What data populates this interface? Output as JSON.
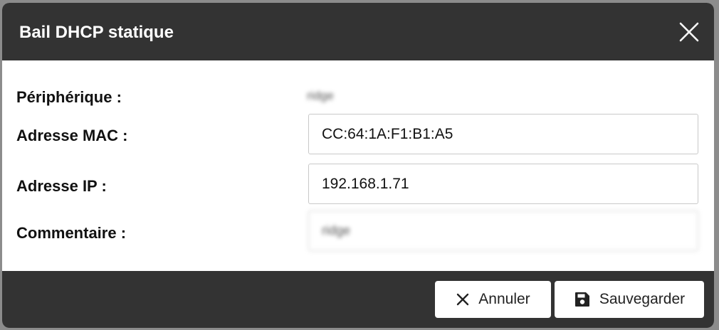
{
  "dialog": {
    "title": "Bail DHCP statique"
  },
  "form": {
    "device_label": "Périphérique :",
    "device_value": "ridge",
    "mac_label": "Adresse MAC :",
    "mac_value": "CC:64:1A:F1:B1:A5",
    "ip_label": "Adresse IP :",
    "ip_value": "192.168.1.71",
    "comment_label": "Commentaire :",
    "comment_value": "ridge"
  },
  "footer": {
    "cancel_label": "Annuler",
    "save_label": "Sauvegarder"
  },
  "icons": {
    "close": "close-icon",
    "cancel": "x-icon",
    "save": "floppy-disk-icon"
  },
  "colors": {
    "header_bg": "#333333",
    "footer_bg": "#333333",
    "button_bg": "#ffffff"
  }
}
